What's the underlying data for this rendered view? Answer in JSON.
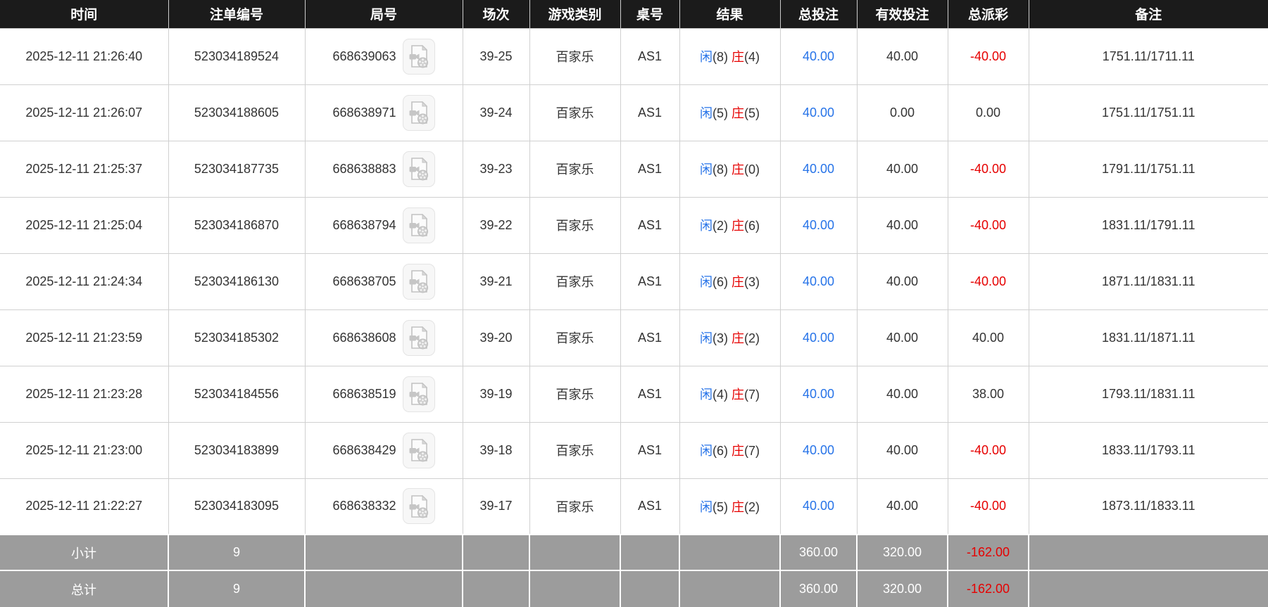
{
  "table": {
    "headers": [
      {
        "key": "time",
        "label": "时间"
      },
      {
        "key": "bet_id",
        "label": "注单编号"
      },
      {
        "key": "round_id",
        "label": "局号"
      },
      {
        "key": "session",
        "label": "场次"
      },
      {
        "key": "game_type",
        "label": "游戏类别"
      },
      {
        "key": "table_no",
        "label": "桌号"
      },
      {
        "key": "result",
        "label": "结果"
      },
      {
        "key": "total_bet",
        "label": "总投注"
      },
      {
        "key": "valid_bet",
        "label": "有效投注"
      },
      {
        "key": "payout",
        "label": "总派彩"
      },
      {
        "key": "remark",
        "label": "备注"
      }
    ],
    "rows": [
      {
        "time": "2025-12-11 21:26:40",
        "bet_id": "523034189524",
        "round_id": "668639063",
        "session": "39-25",
        "game_type": "百家乐",
        "table_no": "AS1",
        "result_player": "闲",
        "result_player_score": "(8)",
        "result_banker": "庄",
        "result_banker_score": "(4)",
        "total_bet": "40.00",
        "valid_bet": "40.00",
        "payout": "-40.00",
        "remark": "1751.11/1711.11"
      },
      {
        "time": "2025-12-11 21:26:07",
        "bet_id": "523034188605",
        "round_id": "668638971",
        "session": "39-24",
        "game_type": "百家乐",
        "table_no": "AS1",
        "result_player": "闲",
        "result_player_score": "(5)",
        "result_banker": "庄",
        "result_banker_score": "(5)",
        "total_bet": "40.00",
        "valid_bet": "0.00",
        "payout": "0.00",
        "remark": "1751.11/1751.11"
      },
      {
        "time": "2025-12-11 21:25:37",
        "bet_id": "523034187735",
        "round_id": "668638883",
        "session": "39-23",
        "game_type": "百家乐",
        "table_no": "AS1",
        "result_player": "闲",
        "result_player_score": "(8)",
        "result_banker": "庄",
        "result_banker_score": "(0)",
        "total_bet": "40.00",
        "valid_bet": "40.00",
        "payout": "-40.00",
        "remark": "1791.11/1751.11"
      },
      {
        "time": "2025-12-11 21:25:04",
        "bet_id": "523034186870",
        "round_id": "668638794",
        "session": "39-22",
        "game_type": "百家乐",
        "table_no": "AS1",
        "result_player": "闲",
        "result_player_score": "(2)",
        "result_banker": "庄",
        "result_banker_score": "(6)",
        "total_bet": "40.00",
        "valid_bet": "40.00",
        "payout": "-40.00",
        "remark": "1831.11/1791.11"
      },
      {
        "time": "2025-12-11 21:24:34",
        "bet_id": "523034186130",
        "round_id": "668638705",
        "session": "39-21",
        "game_type": "百家乐",
        "table_no": "AS1",
        "result_player": "闲",
        "result_player_score": "(6)",
        "result_banker": "庄",
        "result_banker_score": "(3)",
        "total_bet": "40.00",
        "valid_bet": "40.00",
        "payout": "-40.00",
        "remark": "1871.11/1831.11"
      },
      {
        "time": "2025-12-11 21:23:59",
        "bet_id": "523034185302",
        "round_id": "668638608",
        "session": "39-20",
        "game_type": "百家乐",
        "table_no": "AS1",
        "result_player": "闲",
        "result_player_score": "(3)",
        "result_banker": "庄",
        "result_banker_score": "(2)",
        "total_bet": "40.00",
        "valid_bet": "40.00",
        "payout": "40.00",
        "remark": "1831.11/1871.11"
      },
      {
        "time": "2025-12-11 21:23:28",
        "bet_id": "523034184556",
        "round_id": "668638519",
        "session": "39-19",
        "game_type": "百家乐",
        "table_no": "AS1",
        "result_player": "闲",
        "result_player_score": "(4)",
        "result_banker": "庄",
        "result_banker_score": "(7)",
        "total_bet": "40.00",
        "valid_bet": "40.00",
        "payout": "38.00",
        "remark": "1793.11/1831.11"
      },
      {
        "time": "2025-12-11 21:23:00",
        "bet_id": "523034183899",
        "round_id": "668638429",
        "session": "39-18",
        "game_type": "百家乐",
        "table_no": "AS1",
        "result_player": "闲",
        "result_player_score": "(6)",
        "result_banker": "庄",
        "result_banker_score": "(7)",
        "total_bet": "40.00",
        "valid_bet": "40.00",
        "payout": "-40.00",
        "remark": "1833.11/1793.11"
      },
      {
        "time": "2025-12-11 21:22:27",
        "bet_id": "523034183095",
        "round_id": "668638332",
        "session": "39-17",
        "game_type": "百家乐",
        "table_no": "AS1",
        "result_player": "闲",
        "result_player_score": "(5)",
        "result_banker": "庄",
        "result_banker_score": "(2)",
        "total_bet": "40.00",
        "valid_bet": "40.00",
        "payout": "-40.00",
        "remark": "1873.11/1833.11"
      }
    ],
    "footer": {
      "subtotal": {
        "label": "小计",
        "count": "9",
        "total_bet": "360.00",
        "valid_bet": "320.00",
        "payout": "-162.00"
      },
      "grandtotal": {
        "label": "总计",
        "count": "9",
        "total_bet": "360.00",
        "valid_bet": "320.00",
        "payout": "-162.00"
      }
    }
  },
  "icons": {
    "video_replay": "video-file-icon"
  },
  "colors": {
    "header_bg": "#1b1b1b",
    "footer_bg": "#9c9c9c",
    "accent_blue": "#2673e8",
    "accent_red": "#e60000",
    "row_border": "#d0d0d0"
  }
}
